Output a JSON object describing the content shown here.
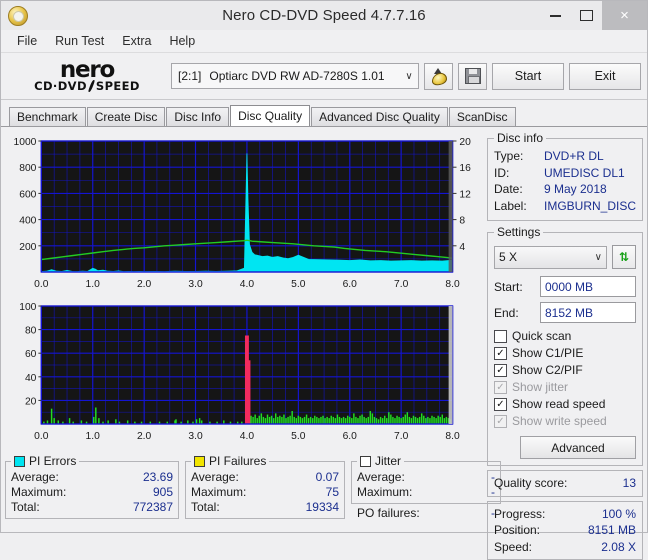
{
  "window": {
    "title": "Nero CD-DVD Speed 4.7.7.16",
    "icon": "nero-app-icon",
    "minimize": "minimize-icon",
    "maximize": "maximize-icon",
    "close": "×"
  },
  "menu": {
    "items": [
      "File",
      "Run Test",
      "Extra",
      "Help"
    ]
  },
  "toolbar": {
    "logo_main": "nero",
    "logo_sub_left": "CD·DVD",
    "logo_sub_right": "SPEED",
    "drive_bay": "[2:1]",
    "drive_name": "Optiarc DVD RW AD-7280S 1.01",
    "caret": "∨",
    "eject_icon": "eject-disc-icon",
    "save_icon": "floppy-save-icon",
    "start_label": "Start",
    "exit_label": "Exit"
  },
  "tabs": [
    {
      "label": "Benchmark",
      "active": false
    },
    {
      "label": "Create Disc",
      "active": false
    },
    {
      "label": "Disc Info",
      "active": false
    },
    {
      "label": "Disc Quality",
      "active": true
    },
    {
      "label": "Advanced Disc Quality",
      "active": false
    },
    {
      "label": "ScanDisc",
      "active": false
    }
  ],
  "disc_info": {
    "legend": "Disc info",
    "rows": [
      {
        "key": "Type:",
        "value": "DVD+R DL"
      },
      {
        "key": "ID:",
        "value": "UMEDISC DL1"
      },
      {
        "key": "Date:",
        "value": "9 May 2018"
      },
      {
        "key": "Label:",
        "value": "IMGBURN_DISC"
      }
    ]
  },
  "settings": {
    "legend": "Settings",
    "speed_value": "5 X",
    "speed_caret": "∨",
    "refresh_icon": "refresh-drive-icon",
    "start_label": "Start:",
    "start_value": "0000 MB",
    "end_label": "End:",
    "end_value": "8152 MB",
    "checks": [
      {
        "label": "Quick scan",
        "checked": false,
        "disabled": false
      },
      {
        "label": "Show C1/PIE",
        "checked": true,
        "disabled": false
      },
      {
        "label": "Show C2/PIF",
        "checked": true,
        "disabled": false
      },
      {
        "label": "Show jitter",
        "checked": true,
        "disabled": true
      },
      {
        "label": "Show read speed",
        "checked": true,
        "disabled": false
      },
      {
        "label": "Show write speed",
        "checked": true,
        "disabled": true
      }
    ],
    "advanced_label": "Advanced"
  },
  "quality": {
    "label": "Quality score:",
    "value": "13"
  },
  "progress": {
    "rows": [
      {
        "key": "Progress:",
        "value": "100 %"
      },
      {
        "key": "Position:",
        "value": "8151 MB"
      },
      {
        "key": "Speed:",
        "value": "2.08 X"
      }
    ]
  },
  "pi_errors": {
    "legend": "PI Errors",
    "swatch": "#00e5f2",
    "rows": [
      {
        "key": "Average:",
        "value": "23.69"
      },
      {
        "key": "Maximum:",
        "value": "905"
      },
      {
        "key": "Total:",
        "value": "772387"
      }
    ]
  },
  "pi_failures": {
    "legend": "PI Failures",
    "swatch": "#f2e500",
    "rows": [
      {
        "key": "Average:",
        "value": "0.07"
      },
      {
        "key": "Maximum:",
        "value": "75"
      },
      {
        "key": "Total:",
        "value": "19334"
      }
    ]
  },
  "jitter": {
    "legend": "Jitter",
    "swatch": "#ffffff",
    "rows": [
      {
        "key": "Average:",
        "value": "-"
      },
      {
        "key": "Maximum:",
        "value": "-"
      }
    ],
    "po_label": "PO failures:",
    "po_value": "-"
  },
  "chart_data": [
    {
      "id": "pi-errors-chart",
      "type": "area",
      "title": "",
      "xlabel": "",
      "ylabel": "",
      "xlim": [
        0,
        8
      ],
      "ylim": [
        0,
        1000
      ],
      "xticks": [
        "0.0",
        "1.0",
        "2.0",
        "3.0",
        "4.0",
        "5.0",
        "6.0",
        "7.0",
        "8.0"
      ],
      "yticks": [
        "200",
        "400",
        "600",
        "800",
        "1000"
      ],
      "y2lim": [
        0,
        20
      ],
      "y2ticks": [
        "4",
        "8",
        "12",
        "16",
        "20"
      ],
      "grid": true,
      "plot_bg": "#151515",
      "grid_color": "#1414d2",
      "series": [
        {
          "name": "PI Errors",
          "color": "#00e5f2",
          "style": "filled-area",
          "axis": "left",
          "x": [
            0.0,
            0.1,
            0.2,
            0.3,
            0.4,
            0.5,
            0.6,
            0.7,
            0.8,
            0.9,
            1.0,
            1.05,
            1.1,
            1.2,
            1.3,
            1.4,
            1.5,
            1.6,
            1.7,
            1.8,
            1.9,
            2.0,
            2.2,
            2.4,
            2.6,
            2.8,
            3.0,
            3.2,
            3.4,
            3.6,
            3.8,
            3.95,
            4.0,
            4.02,
            4.05,
            4.1,
            4.15,
            4.2,
            4.3,
            4.4,
            4.5,
            4.6,
            4.7,
            4.8,
            4.9,
            5.0,
            5.2,
            5.4,
            5.6,
            5.8,
            6.0,
            6.2,
            6.4,
            6.6,
            6.8,
            7.0,
            7.2,
            7.4,
            7.6,
            7.8,
            8.0
          ],
          "y": [
            4,
            6,
            18,
            6,
            5,
            12,
            5,
            4,
            6,
            5,
            28,
            22,
            10,
            14,
            6,
            5,
            8,
            4,
            5,
            4,
            5,
            4,
            5,
            4,
            6,
            5,
            5,
            6,
            5,
            6,
            8,
            30,
            905,
            560,
            210,
            150,
            132,
            128,
            118,
            122,
            112,
            118,
            108,
            102,
            112,
            128,
            96,
            94,
            92,
            90,
            88,
            92,
            86,
            88,
            84,
            86,
            88,
            84,
            86,
            84,
            90
          ]
        },
        {
          "name": "Read speed",
          "color": "#22cc22",
          "style": "line",
          "axis": "right",
          "x": [
            0.0,
            0.2,
            0.4,
            0.6,
            0.8,
            1.0,
            1.2,
            1.4,
            1.6,
            1.8,
            2.0,
            2.2,
            2.4,
            2.6,
            2.8,
            3.0,
            3.2,
            3.4,
            3.6,
            3.8,
            3.95,
            4.0,
            4.1,
            4.3,
            4.5,
            4.7,
            4.9,
            5.1,
            5.3,
            5.5,
            5.7,
            5.9,
            6.1,
            6.3,
            6.5,
            6.7,
            6.9,
            7.1,
            7.3,
            7.5,
            7.7,
            7.9,
            8.0
          ],
          "y": [
            1.9,
            2.1,
            2.3,
            2.5,
            2.7,
            2.9,
            3.1,
            3.3,
            3.45,
            3.6,
            3.7,
            3.85,
            4.0,
            4.1,
            4.2,
            4.3,
            4.4,
            4.5,
            4.6,
            4.7,
            4.78,
            4.85,
            4.7,
            4.6,
            4.5,
            4.4,
            4.3,
            4.15,
            4.0,
            3.9,
            3.8,
            3.6,
            3.45,
            3.3,
            3.2,
            3.1,
            2.95,
            2.8,
            2.65,
            2.5,
            2.35,
            2.2,
            2.1
          ]
        }
      ]
    },
    {
      "id": "pi-failures-chart",
      "type": "bar",
      "title": "",
      "xlabel": "",
      "ylabel": "",
      "xlim": [
        0,
        8
      ],
      "ylim": [
        0,
        100
      ],
      "xticks": [
        "0.0",
        "1.0",
        "2.0",
        "3.0",
        "4.0",
        "5.0",
        "6.0",
        "7.0",
        "8.0"
      ],
      "yticks": [
        "20",
        "40",
        "60",
        "80",
        "100"
      ],
      "grid": true,
      "plot_bg": "#151515",
      "grid_color": "#1414d2",
      "series": [
        {
          "name": "PI Failures (layer 0)",
          "color": "#22dd22",
          "style": "spikes",
          "x": [
            0.05,
            0.12,
            0.2,
            0.25,
            0.33,
            0.42,
            0.55,
            0.62,
            0.78,
            0.88,
            1.02,
            1.06,
            1.12,
            1.2,
            1.3,
            1.45,
            1.52,
            1.68,
            1.82,
            1.95,
            2.12,
            2.3,
            2.45,
            2.6,
            2.62,
            2.72,
            2.85,
            2.95,
            3.02,
            3.08,
            3.12,
            3.28,
            3.42,
            3.55,
            3.68,
            3.82,
            3.9
          ],
          "y": [
            2,
            3,
            13,
            5,
            3,
            2,
            5,
            2,
            3,
            2,
            6,
            14,
            5,
            2,
            3,
            4,
            2,
            3,
            2,
            2,
            2,
            2,
            2,
            3,
            4,
            2,
            3,
            2,
            4,
            5,
            3,
            2,
            2,
            3,
            2,
            2,
            2
          ]
        },
        {
          "name": "PI Failures spike (layer change)",
          "color": "#f22b5e",
          "style": "spikes",
          "x": [
            4.0,
            4.03
          ],
          "y": [
            75,
            54
          ]
        },
        {
          "name": "PI Failures (layer 1)",
          "color": "#22dd22",
          "style": "spikes",
          "x": [
            4.08,
            4.12,
            4.16,
            4.2,
            4.24,
            4.28,
            4.32,
            4.36,
            4.4,
            4.44,
            4.48,
            4.52,
            4.56,
            4.6,
            4.64,
            4.68,
            4.72,
            4.76,
            4.8,
            4.84,
            4.88,
            4.92,
            4.96,
            5.0,
            5.04,
            5.08,
            5.12,
            5.16,
            5.2,
            5.24,
            5.28,
            5.32,
            5.36,
            5.4,
            5.44,
            5.48,
            5.52,
            5.56,
            5.6,
            5.64,
            5.68,
            5.72,
            5.76,
            5.8,
            5.84,
            5.88,
            5.92,
            5.96,
            6.0,
            6.04,
            6.08,
            6.12,
            6.16,
            6.2,
            6.24,
            6.28,
            6.32,
            6.36,
            6.4,
            6.44,
            6.48,
            6.52,
            6.56,
            6.6,
            6.64,
            6.68,
            6.72,
            6.76,
            6.8,
            6.84,
            6.88,
            6.92,
            6.96,
            7.0,
            7.04,
            7.08,
            7.12,
            7.16,
            7.2,
            7.24,
            7.28,
            7.32,
            7.36,
            7.4,
            7.44,
            7.48,
            7.52,
            7.56,
            7.6,
            7.64,
            7.68,
            7.72,
            7.76,
            7.8,
            7.84,
            7.88,
            7.92,
            7.96
          ],
          "y": [
            7,
            6,
            8,
            5,
            7,
            9,
            6,
            5,
            8,
            6,
            7,
            5,
            9,
            6,
            7,
            6,
            8,
            5,
            6,
            7,
            11,
            6,
            5,
            7,
            6,
            5,
            6,
            8,
            5,
            6,
            5,
            7,
            6,
            5,
            6,
            7,
            5,
            6,
            5,
            7,
            6,
            5,
            8,
            6,
            5,
            6,
            5,
            7,
            6,
            5,
            9,
            6,
            5,
            7,
            8,
            6,
            5,
            6,
            11,
            9,
            6,
            5,
            4,
            6,
            5,
            7,
            5,
            10,
            8,
            6,
            5,
            7,
            6,
            5,
            6,
            8,
            10,
            6,
            5,
            7,
            6,
            5,
            6,
            9,
            7,
            5,
            6,
            5,
            7,
            6,
            5,
            7,
            6,
            8,
            5,
            6,
            5,
            4
          ]
        }
      ]
    }
  ]
}
